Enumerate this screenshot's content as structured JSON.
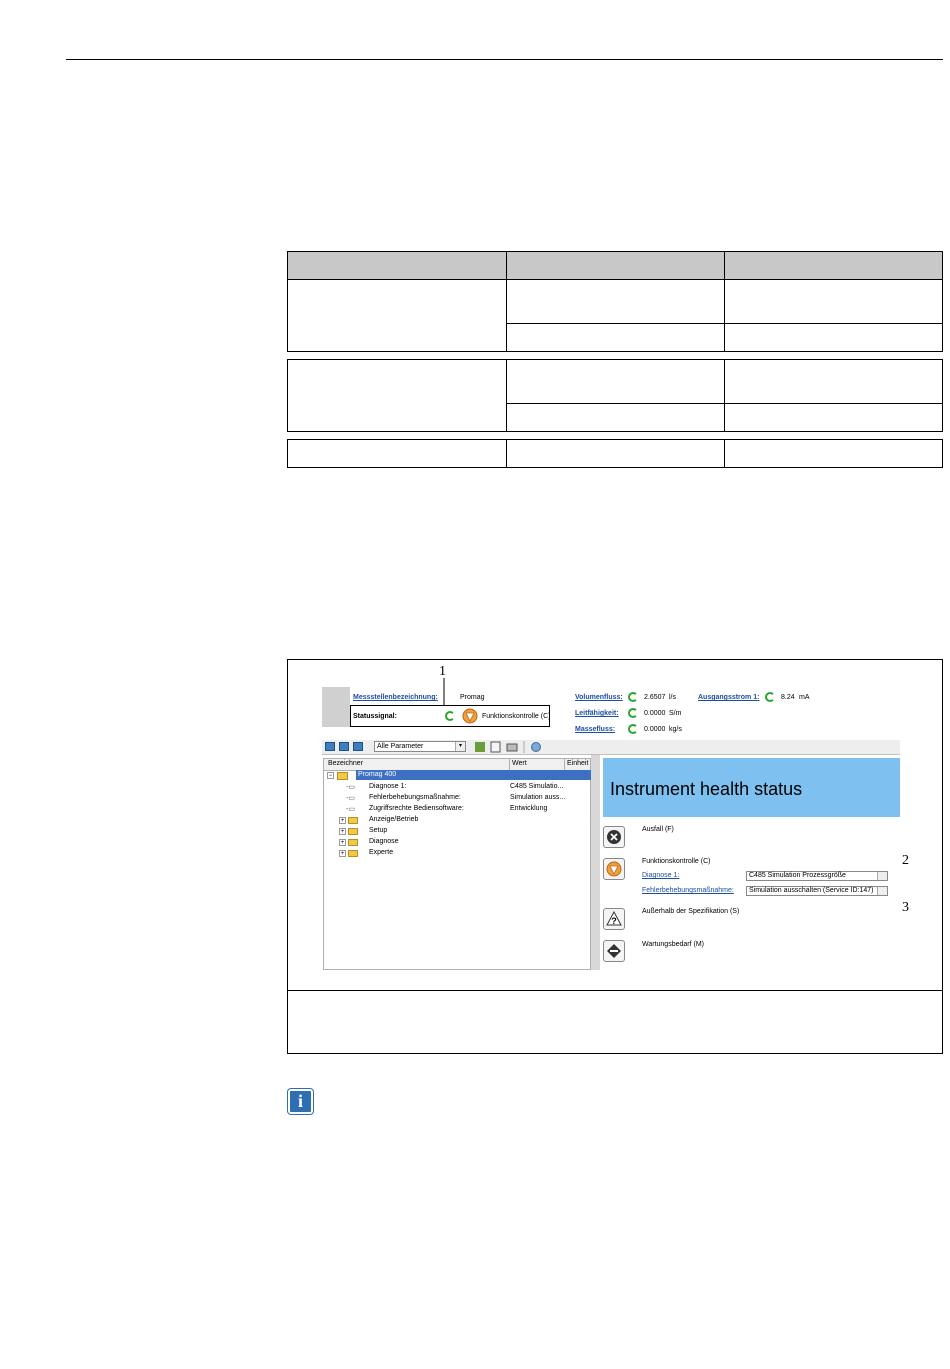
{
  "figure": {
    "callouts": [
      "1",
      "2",
      "3"
    ],
    "header": {
      "tag_label": "Messstellenbezeichnung:",
      "tag_value": "Promag",
      "status_label": "Statussignal:",
      "status_value": "Funktionskontrolle (C)",
      "measurements": [
        {
          "label": "Volumenfluss:",
          "value": "2.6507",
          "unit": "l/s"
        },
        {
          "label": "Leitfähigkeit:",
          "value": "0.0000",
          "unit": "S/m"
        },
        {
          "label": "Massefluss:",
          "value": "0.0000",
          "unit": "kg/s"
        }
      ],
      "output_label": "Ausgangsstrom 1:",
      "output_value": "8.24",
      "output_unit": "mA"
    },
    "toolbar": {
      "select_value": "Alle Parameter"
    },
    "tree": {
      "columns": [
        "Bezeichner",
        "Wert",
        "Einheit"
      ],
      "root": "Promag 400",
      "params": [
        {
          "name": "Diagnose 1:",
          "value": "C485 Simulatio..."
        },
        {
          "name": "Fehlerbehebungsmaßnahme:",
          "value": "Simulation auss..."
        },
        {
          "name": "Zugriffsrechte Bediensoftware:",
          "value": "Entwicklung"
        }
      ],
      "folders": [
        "Anzeige/Betrieb",
        "Setup",
        "Diagnose",
        "Experte"
      ]
    },
    "health": {
      "title": "Instrument health status",
      "failure": "Ausfall (F)",
      "function_check": "Funktionskontrolle (C)",
      "diag_label": "Diagnose 1:",
      "diag_value": "C485 Simulation Prozessgröße",
      "remedy_label": "Fehlerbehebungsmaßnahme:",
      "remedy_value": "Simulation ausschalten  (Service ID:147)",
      "out_of_spec": "Außerhalb der Spezifikation (S)",
      "maintenance": "Wartungsbedarf (M)"
    }
  }
}
